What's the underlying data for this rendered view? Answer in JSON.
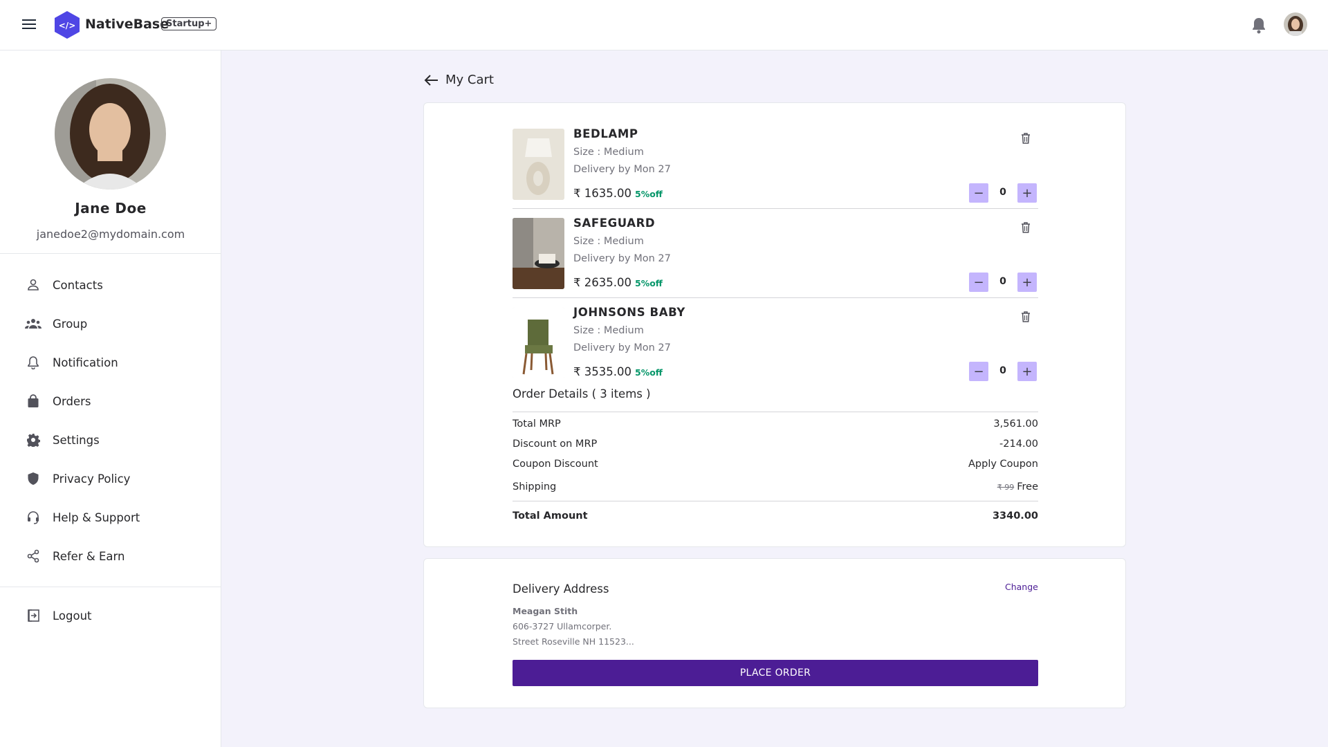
{
  "header": {
    "brand": "NativeBase",
    "plan_badge": "Startup+",
    "icons": [
      "menu-icon",
      "logo-icon",
      "bell-icon",
      "avatar"
    ]
  },
  "profile": {
    "name": "Jane Doe",
    "email": "janedoe2@mydomain.com"
  },
  "sidebar": {
    "items": [
      {
        "label": "Contacts",
        "icon": "user-icon"
      },
      {
        "label": "Group",
        "icon": "group-icon"
      },
      {
        "label": "Notification",
        "icon": "bell-icon"
      },
      {
        "label": "Orders",
        "icon": "shopping-bag-icon"
      },
      {
        "label": "Settings",
        "icon": "gear-icon"
      },
      {
        "label": "Privacy Policy",
        "icon": "shield-icon"
      },
      {
        "label": "Help & Support",
        "icon": "headset-icon"
      },
      {
        "label": "Refer & Earn",
        "icon": "share-icon"
      }
    ],
    "logout": {
      "label": "Logout",
      "icon": "logout-icon"
    }
  },
  "main": {
    "back_label": "My Cart",
    "cart_items": [
      {
        "name": "BEDLAMP",
        "size": "Size : Medium",
        "delivery": "Delivery by Mon 27",
        "price": "₹ 1635.00",
        "discount": "5%off",
        "qty": "0"
      },
      {
        "name": "SAFEGUARD",
        "size": "Size : Medium",
        "delivery": "Delivery by Mon 27",
        "price": "₹ 2635.00",
        "discount": "5%off",
        "qty": "0"
      },
      {
        "name": "JOHNSONS BABY",
        "size": "Size : Medium",
        "delivery": "Delivery by Mon 27",
        "price": "₹ 3535.00",
        "discount": "5%off",
        "qty": "0"
      }
    ],
    "order_details": {
      "title": "Order Details ( 3 items )",
      "total_mrp_label": "Total MRP",
      "total_mrp": "3,561.00",
      "discount_label": "Discount on MRP",
      "discount": "-214.00",
      "coupon_label": "Coupon Discount",
      "coupon_action": "Apply Coupon",
      "shipping_label": "Shipping",
      "shipping_old": "₹ 99",
      "shipping_value": "Free",
      "total_label": "Total Amount",
      "total": "3340.00"
    },
    "delivery": {
      "title": "Delivery Address",
      "change_label": "Change",
      "name": "Meagan Stith",
      "line1": "606-3727 Ullamcorper.",
      "line2": "Street Roseville NH 11523..."
    },
    "place_order_label": "PLACE ORDER"
  },
  "colors": {
    "accent": "#4c1d95",
    "stepper": "#c4b5fd",
    "discount": "#059669",
    "background": "#f3f2fb"
  }
}
